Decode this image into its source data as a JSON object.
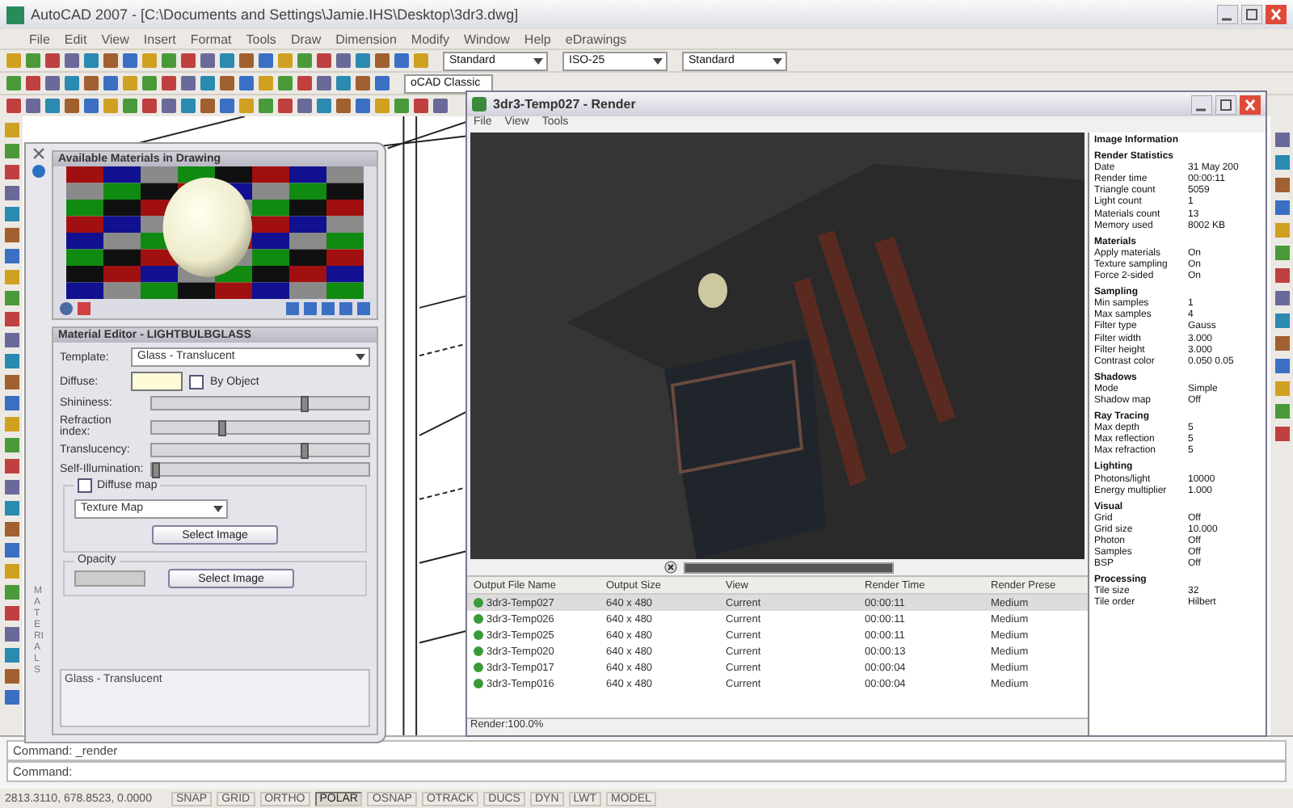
{
  "window": {
    "title": "AutoCAD 2007 - [C:\\Documents and Settings\\Jamie.IHS\\Desktop\\3dr3.dwg]"
  },
  "menu": [
    "File",
    "Edit",
    "View",
    "Insert",
    "Format",
    "Tools",
    "Draw",
    "Dimension",
    "Modify",
    "Window",
    "Help",
    "eDrawings"
  ],
  "toolbar_dropdowns": [
    {
      "value": "Standard"
    },
    {
      "value": "ISO-25"
    },
    {
      "value": "Standard"
    }
  ],
  "workspace_dropdown": {
    "value": "oCAD Classic"
  },
  "materials_palette": {
    "side_label": "MATERIALS",
    "preview_title": "Available Materials in Drawing",
    "editor": {
      "title": "Material Editor - LIGHTBULBGLASS",
      "template_label": "Template:",
      "template": "Glass - Translucent",
      "diffuse_label": "Diffuse:",
      "by_object": {
        "label": "By Object",
        "checked": false
      },
      "sliders": [
        {
          "label": "Shininess:",
          "level": 0.72
        },
        {
          "label": "Refraction index:",
          "level": 0.32
        },
        {
          "label": "Translucency:",
          "level": 0.72
        },
        {
          "label": "Self-Illumination:",
          "level": 0.0
        }
      ],
      "diffuse_map": {
        "label": "Diffuse map",
        "checked": false,
        "map_type": "Texture Map",
        "button": "Select Image"
      },
      "opacity": {
        "label": "Opacity",
        "button": "Select Image"
      },
      "description": "Glass - Translucent"
    }
  },
  "render_window": {
    "title": "3dr3-Temp027 - Render",
    "menu": [
      "File",
      "View",
      "Tools"
    ],
    "history": {
      "columns": [
        "Output File Name",
        "Output Size",
        "View",
        "Render Time",
        "Render Prese"
      ],
      "rows": [
        {
          "cells": [
            "3dr3-Temp027",
            "640 x 480",
            "Current",
            "00:00:11",
            "Medium"
          ],
          "selected": true
        },
        {
          "cells": [
            "3dr3-Temp026",
            "640 x 480",
            "Current",
            "00:00:11",
            "Medium"
          ],
          "selected": false
        },
        {
          "cells": [
            "3dr3-Temp025",
            "640 x 480",
            "Current",
            "00:00:11",
            "Medium"
          ],
          "selected": false
        },
        {
          "cells": [
            "3dr3-Temp020",
            "640 x 480",
            "Current",
            "00:00:13",
            "Medium"
          ],
          "selected": false
        },
        {
          "cells": [
            "3dr3-Temp017",
            "640 x 480",
            "Current",
            "00:00:04",
            "Medium"
          ],
          "selected": false
        },
        {
          "cells": [
            "3dr3-Temp016",
            "640 x 480",
            "Current",
            "00:00:04",
            "Medium"
          ],
          "selected": false
        }
      ]
    },
    "progress": {
      "level": 1.0
    },
    "status": "Render:100.0%",
    "image_information": {
      "title": "Image Information",
      "sections": [
        {
          "heading": "Render Statistics",
          "items": [
            [
              "Date",
              "31 May 200"
            ],
            [
              "Render time",
              "00:00:11"
            ],
            [
              "Triangle count",
              "5059"
            ],
            [
              "Light count",
              "1"
            ],
            [
              "Materials count",
              "13"
            ],
            [
              "Memory used",
              "8002 KB"
            ]
          ]
        },
        {
          "heading": "Materials",
          "items": [
            [
              "Apply materials",
              "On"
            ],
            [
              "Texture sampling",
              "On"
            ],
            [
              "Force 2-sided",
              "On"
            ]
          ]
        },
        {
          "heading": "Sampling",
          "items": [
            [
              "Min samples",
              "1"
            ],
            [
              "Max samples",
              "4"
            ],
            [
              "Filter type",
              "Gauss"
            ],
            [
              "Filter width",
              "3.000"
            ],
            [
              "Filter height",
              "3.000"
            ],
            [
              "Contrast color",
              "0.050 0.05"
            ]
          ]
        },
        {
          "heading": "Shadows",
          "items": [
            [
              "Mode",
              "Simple"
            ],
            [
              "Shadow map",
              "Off"
            ]
          ]
        },
        {
          "heading": "Ray Tracing",
          "items": [
            [
              "Max depth",
              "5"
            ],
            [
              "Max reflection",
              "5"
            ],
            [
              "Max refraction",
              "5"
            ]
          ]
        },
        {
          "heading": "Lighting",
          "items": [
            [
              "Photons/light",
              "10000"
            ],
            [
              "Energy multiplier",
              "1.000"
            ]
          ]
        },
        {
          "heading": "Visual",
          "items": [
            [
              "Grid",
              "Off"
            ],
            [
              "Grid size",
              "10.000"
            ],
            [
              "Photon",
              "Off"
            ],
            [
              "Samples",
              "Off"
            ],
            [
              "BSP",
              "Off"
            ]
          ]
        },
        {
          "heading": "Processing",
          "items": [
            [
              "Tile size",
              "32"
            ],
            [
              "Tile order",
              "Hilbert"
            ]
          ]
        }
      ]
    }
  },
  "command_lines": [
    "Command:  _render",
    "Command:"
  ],
  "status_bar": {
    "coordinates": "2813.3110, 678.8523, 0.0000",
    "toggles": [
      {
        "label": "SNAP",
        "on": false
      },
      {
        "label": "GRID",
        "on": false
      },
      {
        "label": "ORTHO",
        "on": false
      },
      {
        "label": "POLAR",
        "on": true
      },
      {
        "label": "OSNAP",
        "on": false
      },
      {
        "label": "OTRACK",
        "on": false
      },
      {
        "label": "DUCS",
        "on": false
      },
      {
        "label": "DYN",
        "on": false
      },
      {
        "label": "LWT",
        "on": false
      },
      {
        "label": "MODEL",
        "on": false
      }
    ]
  }
}
